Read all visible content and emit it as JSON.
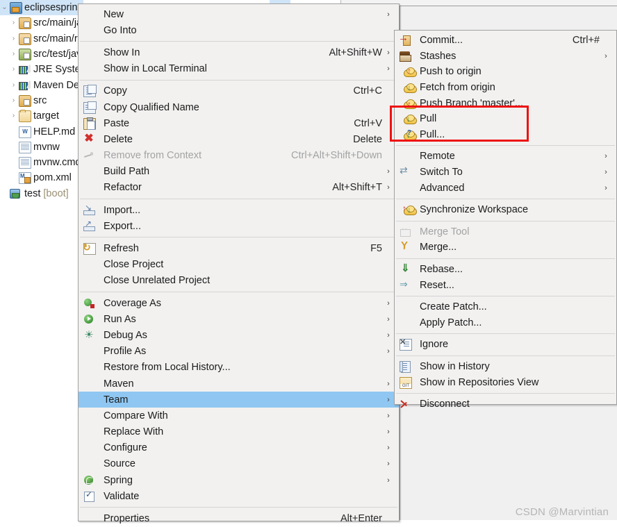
{
  "app": {
    "watermark": "CSDN @Marvintian",
    "highlight_color": "#8fc7f2",
    "selection_color": "#cfe4f7",
    "annotation_color": "#ee1111",
    "menu_background": "#f2f1f0"
  },
  "package_explorer": {
    "name": "Package Explorer tree",
    "items": [
      {
        "label": "eclipsespring",
        "icon": "java-project-icon",
        "expandable": true,
        "expanded": true,
        "selected": true,
        "indent": 0
      },
      {
        "label": "src/main/java",
        "icon": "source-folder-icon",
        "expandable": true,
        "expanded": false,
        "selected": false,
        "indent": 1
      },
      {
        "label": "src/main/resources",
        "icon": "source-folder-resources-icon",
        "expandable": true,
        "expanded": false,
        "selected": false,
        "indent": 1
      },
      {
        "label": "src/test/java",
        "icon": "source-folder-test-icon",
        "expandable": true,
        "expanded": false,
        "selected": false,
        "indent": 1
      },
      {
        "label": "JRE System Library",
        "icon": "library-icon",
        "expandable": true,
        "expanded": false,
        "selected": false,
        "indent": 1
      },
      {
        "label": "Maven Dependencies",
        "icon": "library-icon",
        "expandable": true,
        "expanded": false,
        "selected": false,
        "indent": 1
      },
      {
        "label": "src",
        "icon": "source-folder-icon",
        "expandable": true,
        "expanded": false,
        "selected": false,
        "indent": 1
      },
      {
        "label": "target",
        "icon": "folder-icon",
        "expandable": true,
        "expanded": false,
        "selected": false,
        "indent": 1
      },
      {
        "label": "HELP.md",
        "icon": "markdown-file-icon",
        "expandable": false,
        "expanded": false,
        "selected": false,
        "indent": 1
      },
      {
        "label": "mvnw",
        "icon": "file-icon",
        "expandable": false,
        "expanded": false,
        "selected": false,
        "indent": 1
      },
      {
        "label": "mvnw.cmd",
        "icon": "file-icon",
        "expandable": false,
        "expanded": false,
        "selected": false,
        "indent": 1
      },
      {
        "label": "pom.xml",
        "icon": "maven-pom-icon",
        "expandable": false,
        "expanded": false,
        "selected": false,
        "indent": 1
      },
      {
        "label": "test ",
        "suffix": "[boot]",
        "icon": "spring-boot-project-icon",
        "expandable": false,
        "expanded": false,
        "selected": false,
        "indent": 0
      }
    ]
  },
  "context_menu": {
    "name": "project-context-menu",
    "items": [
      {
        "label": "New",
        "icon": "",
        "accel": "",
        "submenu": true,
        "disabled": false
      },
      {
        "label": "Go Into",
        "icon": "",
        "accel": "",
        "submenu": false,
        "disabled": false
      },
      {
        "separator": true
      },
      {
        "label": "Show In",
        "icon": "",
        "accel": "Alt+Shift+W",
        "submenu": true,
        "disabled": false
      },
      {
        "label": "Show in Local Terminal",
        "icon": "",
        "accel": "",
        "submenu": true,
        "disabled": false
      },
      {
        "separator": true
      },
      {
        "label": "Copy",
        "icon": "copy",
        "accel": "Ctrl+C",
        "submenu": false,
        "disabled": false
      },
      {
        "label": "Copy Qualified Name",
        "icon": "copyq",
        "accel": "",
        "submenu": false,
        "disabled": false
      },
      {
        "label": "Paste",
        "icon": "paste",
        "accel": "Ctrl+V",
        "submenu": false,
        "disabled": false
      },
      {
        "label": "Delete",
        "icon": "delete",
        "accel": "Delete",
        "submenu": false,
        "disabled": false
      },
      {
        "label": "Remove from Context",
        "icon": "ctxrm",
        "accel": "Ctrl+Alt+Shift+Down",
        "submenu": false,
        "disabled": true
      },
      {
        "label": "Build Path",
        "icon": "",
        "accel": "",
        "submenu": true,
        "disabled": false
      },
      {
        "label": "Refactor",
        "icon": "",
        "accel": "Alt+Shift+T",
        "submenu": true,
        "disabled": false
      },
      {
        "separator": true
      },
      {
        "label": "Import...",
        "icon": "import",
        "accel": "",
        "submenu": false,
        "disabled": false
      },
      {
        "label": "Export...",
        "icon": "export",
        "accel": "",
        "submenu": false,
        "disabled": false
      },
      {
        "separator": true
      },
      {
        "label": "Refresh",
        "icon": "refresh",
        "accel": "F5",
        "submenu": false,
        "disabled": false
      },
      {
        "label": "Close Project",
        "icon": "",
        "accel": "",
        "submenu": false,
        "disabled": false
      },
      {
        "label": "Close Unrelated Project",
        "icon": "",
        "accel": "",
        "submenu": false,
        "disabled": false
      },
      {
        "separator": true
      },
      {
        "label": "Coverage As",
        "icon": "coverage",
        "accel": "",
        "submenu": true,
        "disabled": false
      },
      {
        "label": "Run As",
        "icon": "run",
        "accel": "",
        "submenu": true,
        "disabled": false
      },
      {
        "label": "Debug As",
        "icon": "debug",
        "accel": "",
        "submenu": true,
        "disabled": false
      },
      {
        "label": "Profile As",
        "icon": "",
        "accel": "",
        "submenu": true,
        "disabled": false
      },
      {
        "label": "Restore from Local History...",
        "icon": "",
        "accel": "",
        "submenu": false,
        "disabled": false
      },
      {
        "label": "Maven",
        "icon": "",
        "accel": "",
        "submenu": true,
        "disabled": false
      },
      {
        "label": "Team",
        "icon": "",
        "accel": "",
        "submenu": true,
        "disabled": false,
        "selected": true
      },
      {
        "label": "Compare With",
        "icon": "",
        "accel": "",
        "submenu": true,
        "disabled": false
      },
      {
        "label": "Replace With",
        "icon": "",
        "accel": "",
        "submenu": true,
        "disabled": false
      },
      {
        "label": "Configure",
        "icon": "",
        "accel": "",
        "submenu": true,
        "disabled": false
      },
      {
        "label": "Source",
        "icon": "",
        "accel": "",
        "submenu": true,
        "disabled": false
      },
      {
        "label": "Spring",
        "icon": "spring",
        "accel": "",
        "submenu": true,
        "disabled": false
      },
      {
        "label": "Validate",
        "icon": "validate",
        "accel": "",
        "submenu": false,
        "disabled": false
      },
      {
        "separator": true
      },
      {
        "label": "Properties",
        "icon": "",
        "accel": "Alt+Enter",
        "submenu": false,
        "disabled": false
      }
    ]
  },
  "team_submenu": {
    "name": "team-submenu",
    "items": [
      {
        "label": "Commit...",
        "icon": "commit",
        "accel": "Ctrl+#",
        "submenu": false,
        "disabled": false
      },
      {
        "label": "Stashes",
        "icon": "stash",
        "accel": "",
        "submenu": true,
        "disabled": false
      },
      {
        "label": "Push to origin",
        "icon": "push",
        "accel": "",
        "submenu": false,
        "disabled": false
      },
      {
        "label": "Fetch from origin",
        "icon": "fetch",
        "accel": "",
        "submenu": false,
        "disabled": false
      },
      {
        "label": "Push Branch 'master'...",
        "icon": "pushb",
        "accel": "",
        "submenu": false,
        "disabled": false
      },
      {
        "label": "Pull",
        "icon": "pull",
        "accel": "",
        "submenu": false,
        "disabled": false,
        "annotated": true
      },
      {
        "label": "Pull...",
        "icon": "pulldots",
        "accel": "",
        "submenu": false,
        "disabled": false,
        "annotated": true
      },
      {
        "separator": true
      },
      {
        "label": "Remote",
        "icon": "",
        "accel": "",
        "submenu": true,
        "disabled": false
      },
      {
        "label": "Switch To",
        "icon": "switchto",
        "accel": "",
        "submenu": true,
        "disabled": false
      },
      {
        "label": "Advanced",
        "icon": "",
        "accel": "",
        "submenu": true,
        "disabled": false
      },
      {
        "separator": true
      },
      {
        "label": "Synchronize Workspace",
        "icon": "sync",
        "accel": "",
        "submenu": false,
        "disabled": false
      },
      {
        "separator": true
      },
      {
        "label": "Merge Tool",
        "icon": "mergetool",
        "accel": "",
        "submenu": false,
        "disabled": true
      },
      {
        "label": "Merge...",
        "icon": "merge",
        "accel": "",
        "submenu": false,
        "disabled": false
      },
      {
        "separator": true
      },
      {
        "label": "Rebase...",
        "icon": "rebase",
        "accel": "",
        "submenu": false,
        "disabled": false
      },
      {
        "label": "Reset...",
        "icon": "reset",
        "accel": "",
        "submenu": false,
        "disabled": false
      },
      {
        "separator": true
      },
      {
        "label": "Create Patch...",
        "icon": "",
        "accel": "",
        "submenu": false,
        "disabled": false
      },
      {
        "label": "Apply Patch...",
        "icon": "",
        "accel": "",
        "submenu": false,
        "disabled": false
      },
      {
        "separator": true
      },
      {
        "label": "Ignore",
        "icon": "ignore",
        "accel": "",
        "submenu": false,
        "disabled": false
      },
      {
        "separator": true
      },
      {
        "label": "Show in History",
        "icon": "history",
        "accel": "",
        "submenu": false,
        "disabled": false
      },
      {
        "label": "Show in Repositories View",
        "icon": "repoview",
        "accel": "",
        "submenu": false,
        "disabled": false
      },
      {
        "separator": true
      },
      {
        "label": "Disconnect",
        "icon": "disconnect",
        "accel": "",
        "submenu": false,
        "disabled": false
      }
    ]
  }
}
